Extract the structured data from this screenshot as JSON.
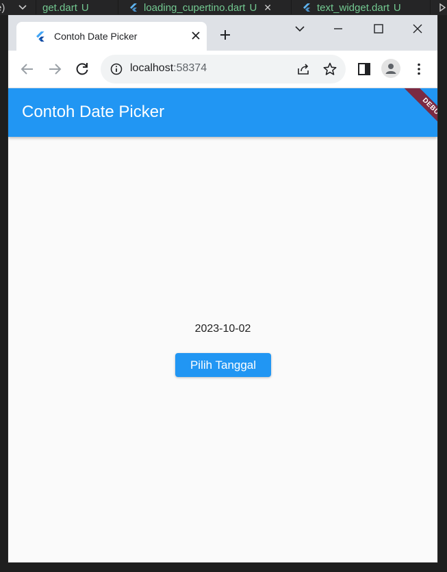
{
  "editor": {
    "tabs": [
      {
        "name": "get.dart",
        "status": "U"
      },
      {
        "name": "loading_cupertino.dart",
        "status": "U"
      },
      {
        "name": "text_widget.dart",
        "status": "U"
      }
    ],
    "status_color": "#73c991"
  },
  "browser": {
    "tab": {
      "title": "Contoh Date Picker",
      "favicon": "flutter-icon"
    },
    "url": {
      "host": "localhost",
      "port": ":58374"
    }
  },
  "app": {
    "appbar_title": "Contoh Date Picker",
    "debug_banner": "DEBUG",
    "selected_date": "2023-10-02",
    "pick_button_label": "Pilih Tanggal",
    "colors": {
      "primary": "#2196f3",
      "debug": "#7b2a43",
      "background": "#fafafa"
    }
  }
}
